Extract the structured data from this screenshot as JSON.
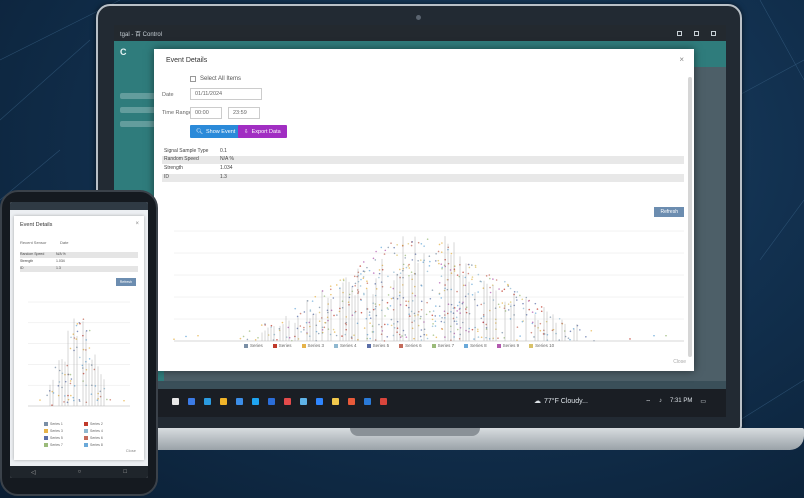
{
  "app": {
    "window_title": "tgal - 百 Control",
    "logo_text": "C"
  },
  "modal": {
    "title": "Event Details",
    "close_label": "×",
    "checkbox_label": "Select All Items",
    "date_label": "Date",
    "date_value": "01/11/2024",
    "time_label": "Time Range",
    "time_start": "00:00",
    "time_end": "23:59",
    "primary_button": "Show Event",
    "secondary_button": "Export Data",
    "info_rows": [
      {
        "key": "Signal Sample Type",
        "value": "0.1"
      },
      {
        "key": "Random Speed",
        "value": "N/A %"
      },
      {
        "key": "Strength",
        "value": "1.034"
      },
      {
        "key": "ID",
        "value": "1.3"
      }
    ],
    "refresh_button": "Refresh",
    "footer_link": "Close",
    "legend": [
      "Series",
      "Series",
      "Series 3",
      "Series 4",
      "Series 5",
      "Series 6",
      "Series 7",
      "Series 8",
      "Series 9",
      "Series 10"
    ],
    "legend_colors": [
      "#7a8fa6",
      "#c0392b",
      "#e6b34a",
      "#8fb8d0",
      "#5b6fa8",
      "#c46b5b",
      "#9bbb7a",
      "#6aa9d9",
      "#b35bb0",
      "#d9c26a"
    ]
  },
  "taskbar": {
    "weather": "77°F Cloudy...",
    "tray_time": "7:31 PM",
    "icon_colors": [
      "#e8e8e8",
      "#3b7be6",
      "#2b9be0",
      "#f0b429",
      "#3c8ee8",
      "#1ea4f0",
      "#2b6ed9",
      "#e34b4b",
      "#5fb3e8",
      "#2f86ff",
      "#f2c94c",
      "#e85a3a",
      "#2a7ad8",
      "#d9453c"
    ]
  },
  "phone": {
    "title": "Event Details",
    "close_label": "×",
    "date_label": "Recent Sensor",
    "date_value": "Date",
    "rows": [
      {
        "key": "Random Speed",
        "value": "N/A %"
      },
      {
        "key": "Strength",
        "value": "1.034"
      },
      {
        "key": "ID",
        "value": "1.3"
      }
    ],
    "refresh_button": "Refresh",
    "footer_link": "Close",
    "legend": [
      "Series 1",
      "Series 2",
      "Series 3",
      "Series 4",
      "Series 5",
      "Series 6",
      "Series 7",
      "Series 8"
    ],
    "legend_colors": [
      "#7a8fa6",
      "#c0392b",
      "#e6b34a",
      "#8fb8d0",
      "#5b6fa8",
      "#c46b5b",
      "#9bbb7a",
      "#6aa9d9"
    ]
  },
  "chart_data": {
    "type": "scatter",
    "note_shape": "bell-shaped cluster of stacked points across 10 series",
    "series_count": 10,
    "peak_index": 60,
    "x_ticks": [
      "",
      "",
      "",
      "",
      "",
      "",
      "",
      "",
      ""
    ],
    "y_ticks": [
      "",
      "",
      "",
      "",
      "",
      ""
    ],
    "grid": true
  }
}
